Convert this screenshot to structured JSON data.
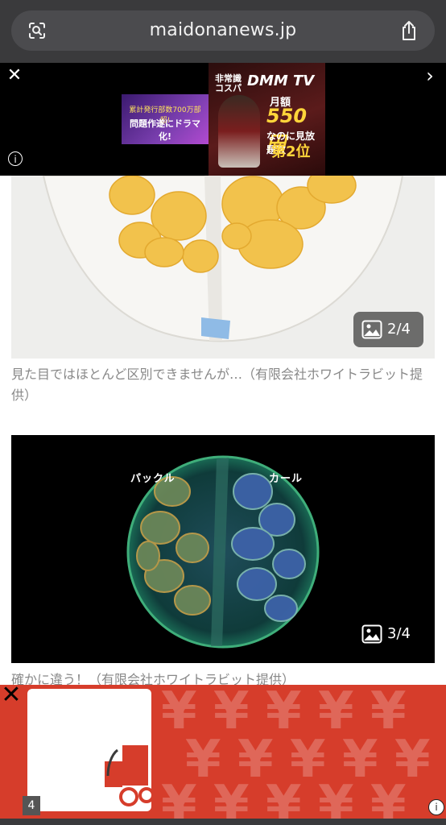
{
  "browser": {
    "url": "maidonanews.jp",
    "lens_icon": "lens-icon",
    "share_icon": "share-icon"
  },
  "top_ad": {
    "close": "✕",
    "next": "›",
    "info": "i",
    "left_creative": {
      "line1": "累計発行部数700万部超!",
      "line2": "問題作遂にドラマ化!"
    },
    "right_creative": {
      "tag": "非常識コスパ",
      "brand": "DMM TV",
      "price_label": "月額",
      "price": "550円",
      "sub": "なのに見放題数",
      "rank": "第2位"
    }
  },
  "article": {
    "gallery": [
      {
        "counter": "2/4",
        "caption": "見た目ではほとんど区別できませんが…（有限会社ホワイトラビット提供）"
      },
      {
        "counter": "3/4",
        "caption": "確かに違う！（有限会社ホワイトラビット提供）",
        "labels": {
          "left": "パックル",
          "right": "カール"
        }
      }
    ]
  },
  "bottom_ad": {
    "close": "✕",
    "number": "4",
    "info": "i",
    "pattern_glyph": "¥"
  },
  "colors": {
    "browser_bar": "#3a3a3c",
    "ad_red": "#d63d2b",
    "caption_gray": "#888888"
  }
}
